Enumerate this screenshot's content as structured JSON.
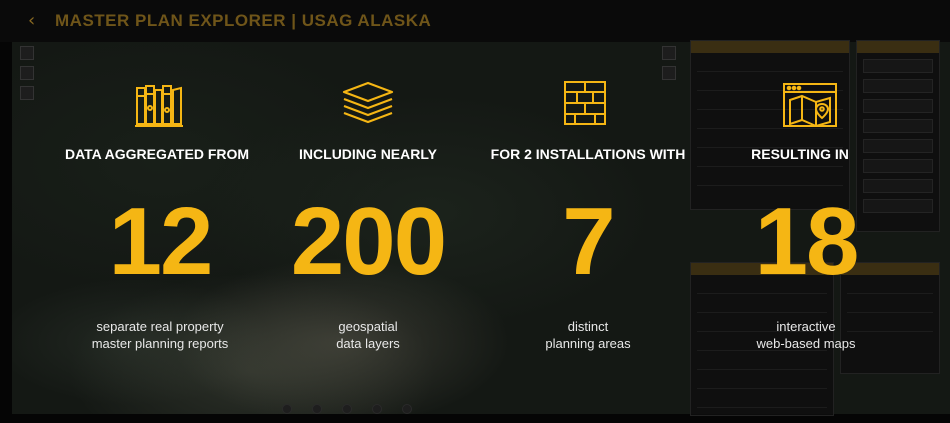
{
  "header": {
    "back_icon": "chevron-left-icon",
    "title": "MASTER PLAN EXPLORER | USAG ALASKA"
  },
  "colors": {
    "accent": "#f5b614",
    "title_muted": "#6f5519",
    "background": "#050505"
  },
  "stats": [
    {
      "icon": "bookshelf-icon",
      "heading": "DATA AGGREGATED FROM",
      "number": "12",
      "desc_line1": "separate real property",
      "desc_line2": "master planning reports"
    },
    {
      "icon": "layers-icon",
      "heading": "INCLUDING NEARLY",
      "number": "200",
      "desc_line1": "geospatial",
      "desc_line2": "data layers"
    },
    {
      "icon": "floor-plan-grid-icon",
      "heading": "FOR 2 INSTALLATIONS WITH",
      "number": "7",
      "desc_line1": "distinct",
      "desc_line2": "planning areas"
    },
    {
      "icon": "web-map-icon",
      "heading": "RESULTING IN",
      "number": "18",
      "desc_line1": "interactive",
      "desc_line2": "web-based maps"
    }
  ]
}
